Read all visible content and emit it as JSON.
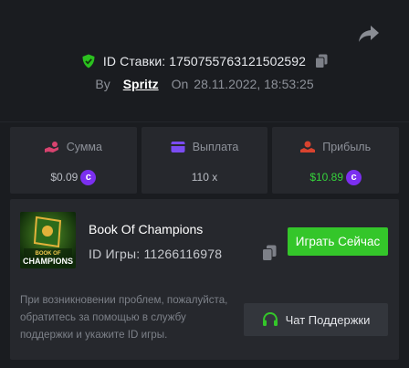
{
  "bet": {
    "label": "ID Ставки: 1750755763121502592",
    "by_label": "By",
    "user": "Spritz",
    "on_label": "On",
    "datetime": "28.11.2022, 18:53:25"
  },
  "stats": [
    {
      "label": "Сумма",
      "value": "$0.09",
      "has_coin": true,
      "icon": "hand-coin-icon",
      "icon_color": "#d8436f"
    },
    {
      "label": "Выплата",
      "value": "110 x",
      "has_coin": false,
      "icon": "wallet-icon",
      "icon_color": "#7b4cf2"
    },
    {
      "label": "Прибыль",
      "value": "$10.89",
      "has_coin": true,
      "icon": "money-hand-icon",
      "icon_color": "#d8432f"
    }
  ],
  "game": {
    "title": "Book Of Champions",
    "id_label": "ID Игры: 11266116978",
    "thumb_text_line1": "BOOK OF",
    "thumb_text_line2": "CHAMPIONS",
    "play_button": "Играть Сейчас"
  },
  "support": {
    "help_text": "При возникновении проблем, пожалуйста, обратитесь за помощью в службу поддержки и укажите ID игры.",
    "button": "Чат Поддержки"
  },
  "colors": {
    "background": "#1a1c20",
    "card": "#26282d",
    "accent_green": "#34c62a",
    "profit_green": "#35d23b",
    "coin_purple": "#7b2ff0"
  }
}
